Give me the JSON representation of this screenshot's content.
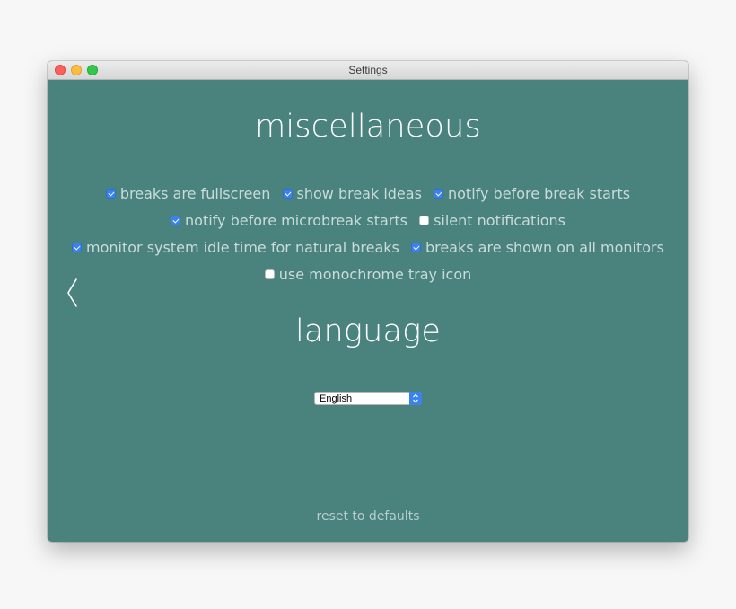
{
  "window": {
    "title": "Settings"
  },
  "sections": {
    "miscellaneous": {
      "heading": "miscellaneous",
      "options": [
        {
          "label": "breaks are fullscreen",
          "checked": true
        },
        {
          "label": "show break ideas",
          "checked": true
        },
        {
          "label": "notify before break starts",
          "checked": true
        },
        {
          "label": "notify before microbreak starts",
          "checked": true
        },
        {
          "label": "silent notifications",
          "checked": false
        },
        {
          "label": "monitor system idle time for natural breaks",
          "checked": true
        },
        {
          "label": "breaks are shown on all monitors",
          "checked": true
        },
        {
          "label": "use monochrome tray icon",
          "checked": false
        }
      ]
    },
    "language": {
      "heading": "language",
      "selected": "English"
    }
  },
  "footer": {
    "reset_label": "reset to defaults"
  },
  "icons": {
    "back": "chevron-left-icon"
  },
  "colors": {
    "background": "#4a827e",
    "accent": "#3b82f0"
  }
}
